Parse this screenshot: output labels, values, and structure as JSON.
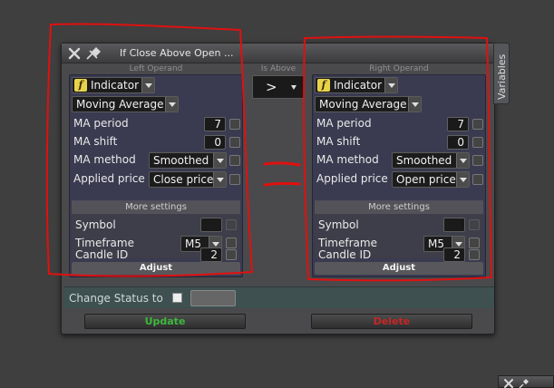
{
  "dialog": {
    "title": "If Close Above Open ...",
    "close_icon": "close-icon",
    "pin_icon": "pin-icon"
  },
  "captions": {
    "left": "Left Operand",
    "middle": "Is Above",
    "right": "Right Operand"
  },
  "comparison": {
    "operator": ">"
  },
  "left_operand": {
    "type": "Indicator",
    "indicator": "Moving Average",
    "ma_period_label": "MA period",
    "ma_period": "7",
    "ma_shift_label": "MA shift",
    "ma_shift": "0",
    "ma_method_label": "MA method",
    "ma_method": "Smoothed",
    "applied_price_label": "Applied price",
    "applied_price": "Close price",
    "more_settings": "More settings",
    "symbol_label": "Symbol",
    "symbol": "",
    "timeframe_label": "Timeframe",
    "timeframe": "M5",
    "candle_id_label": "Candle ID",
    "candle_id": "2",
    "adjust": "Adjust"
  },
  "right_operand": {
    "type": "Indicator",
    "indicator": "Moving Average",
    "ma_period_label": "MA period",
    "ma_period": "7",
    "ma_shift_label": "MA shift",
    "ma_shift": "0",
    "ma_method_label": "MA method",
    "ma_method": "Smoothed",
    "applied_price_label": "Applied price",
    "applied_price": "Open price",
    "more_settings": "More settings",
    "symbol_label": "Symbol",
    "symbol": "",
    "timeframe_label": "Timeframe",
    "timeframe": "M5",
    "candle_id_label": "Candle ID",
    "candle_id": "2",
    "adjust": "Adjust"
  },
  "status": {
    "label": "Change Status to"
  },
  "buttons": {
    "update": "Update",
    "delete": "Delete",
    "update_color": "#3db83d",
    "delete_color": "#c62626"
  },
  "side_tab": {
    "label": "Variables"
  },
  "colors": {
    "annotation_red": "#e01010",
    "panel_bg": "#3a3a50",
    "dialog_bg": "#4a4a4c"
  }
}
